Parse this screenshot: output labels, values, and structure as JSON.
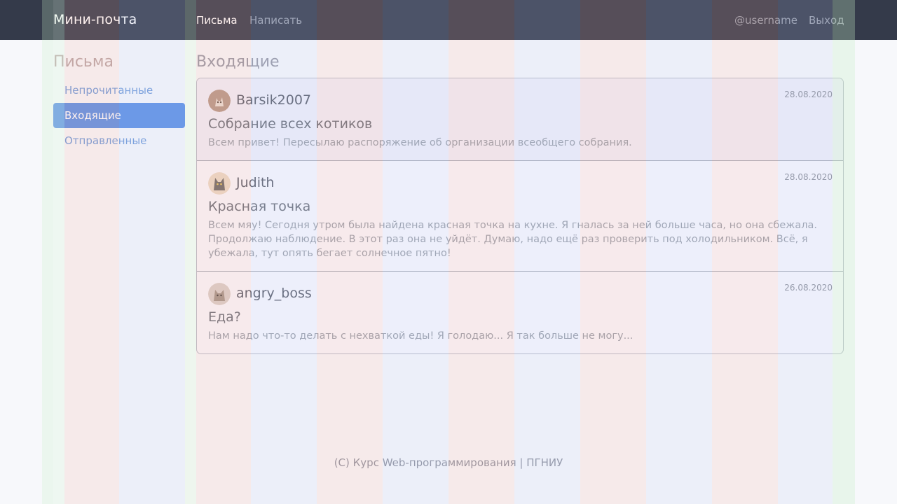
{
  "app": {
    "brand": "Мини-почта",
    "nav": {
      "letters": "Письма",
      "compose": "Написать"
    },
    "user": {
      "username": "@username",
      "logout": "Выход"
    }
  },
  "sidebar": {
    "title": "Письма",
    "items": [
      {
        "label": "Непрочитанные",
        "active": false
      },
      {
        "label": "Входящие",
        "active": true
      },
      {
        "label": "Отправленные",
        "active": false
      }
    ]
  },
  "main": {
    "title": "Входящие",
    "messages": [
      {
        "sender": "Barsik2007",
        "date": "28.08.2020",
        "subject": "Собрание всех котиков",
        "preview": "Всем привет! Пересылаю распоряжение об организации всеобщего собрания.",
        "unread": true,
        "avatar_icon": "cat-avatar-icon"
      },
      {
        "sender": "Judith",
        "date": "28.08.2020",
        "subject": "Красная точка",
        "preview": "Всем мяу! Сегодня утром была найдена красная точка на кухне. Я гналась за ней больше часа, но она сбежала. Продолжаю наблюдение. В этот раз она не уйдёт. Думаю, надо ещё раз проверить под холодильником. Всё, я убежала, тут опять бегает солнечное пятно!",
        "unread": false,
        "avatar_icon": "cat-avatar-icon"
      },
      {
        "sender": "angry_boss",
        "date": "26.08.2020",
        "subject": "Еда?",
        "preview": "Нам надо что-то делать с нехваткой еды! Я голодаю... Я так больше не могу...",
        "unread": false,
        "avatar_icon": "cat-avatar-icon"
      }
    ]
  },
  "footer": {
    "text": "(C) Курс Web-программирования | ПГНИУ"
  },
  "colors": {
    "navbar": "#343a4a",
    "accent": "#5b8fe4",
    "link": "#6f9ad8",
    "unread_bg": "#efeff9"
  }
}
